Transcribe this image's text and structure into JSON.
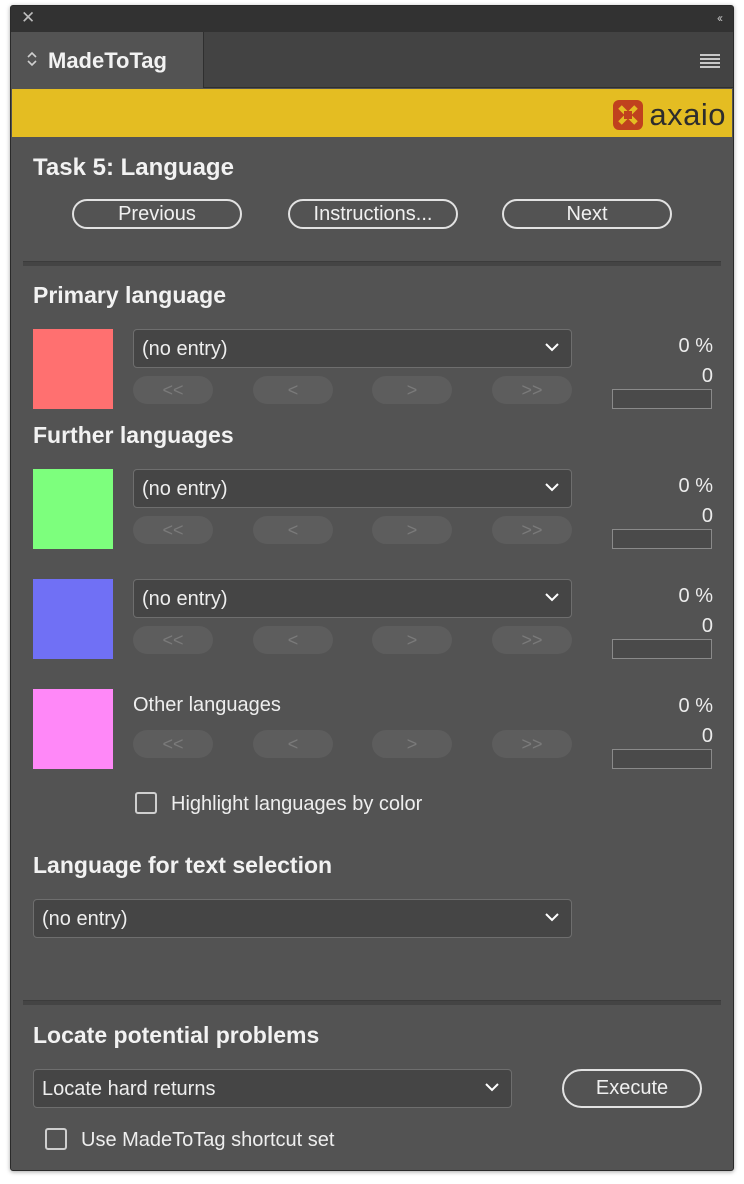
{
  "window": {
    "close_glyph": "✕",
    "collapse_glyph": "‹‹"
  },
  "tab": {
    "title": "MadeToTag",
    "icon": "updown-chevron-icon"
  },
  "brand": {
    "name": "axaio",
    "bar_color": "#e4bd22",
    "logo_color": "#c0411e"
  },
  "task": {
    "title": "Task 5: Language",
    "buttons": {
      "previous": "Previous",
      "instructions": "Instructions...",
      "next": "Next"
    }
  },
  "nav_labels": {
    "first": "<<",
    "prev": "<",
    "next": ">",
    "last": ">>"
  },
  "primary": {
    "heading": "Primary language",
    "color": "#ff7070",
    "value": "(no entry)",
    "percent": "0 %",
    "count": "0",
    "progress": 0
  },
  "further": {
    "heading": "Further languages",
    "items": [
      {
        "color": "#7dff7d",
        "value": "(no entry)",
        "percent": "0 %",
        "count": "0",
        "progress": 0
      },
      {
        "color": "#7070f5",
        "value": "(no entry)",
        "percent": "0 %",
        "count": "0",
        "progress": 0
      }
    ],
    "other": {
      "color": "#ff88f8",
      "label": "Other languages",
      "percent": "0 %",
      "count": "0",
      "progress": 0
    }
  },
  "highlight": {
    "label": "Highlight languages by color",
    "checked": false
  },
  "selection": {
    "heading": "Language for text selection",
    "value": "(no entry)"
  },
  "problems": {
    "heading": "Locate potential problems",
    "value": "Locate hard returns",
    "execute": "Execute"
  },
  "shortcut": {
    "label": "Use MadeToTag shortcut set",
    "checked": false
  }
}
